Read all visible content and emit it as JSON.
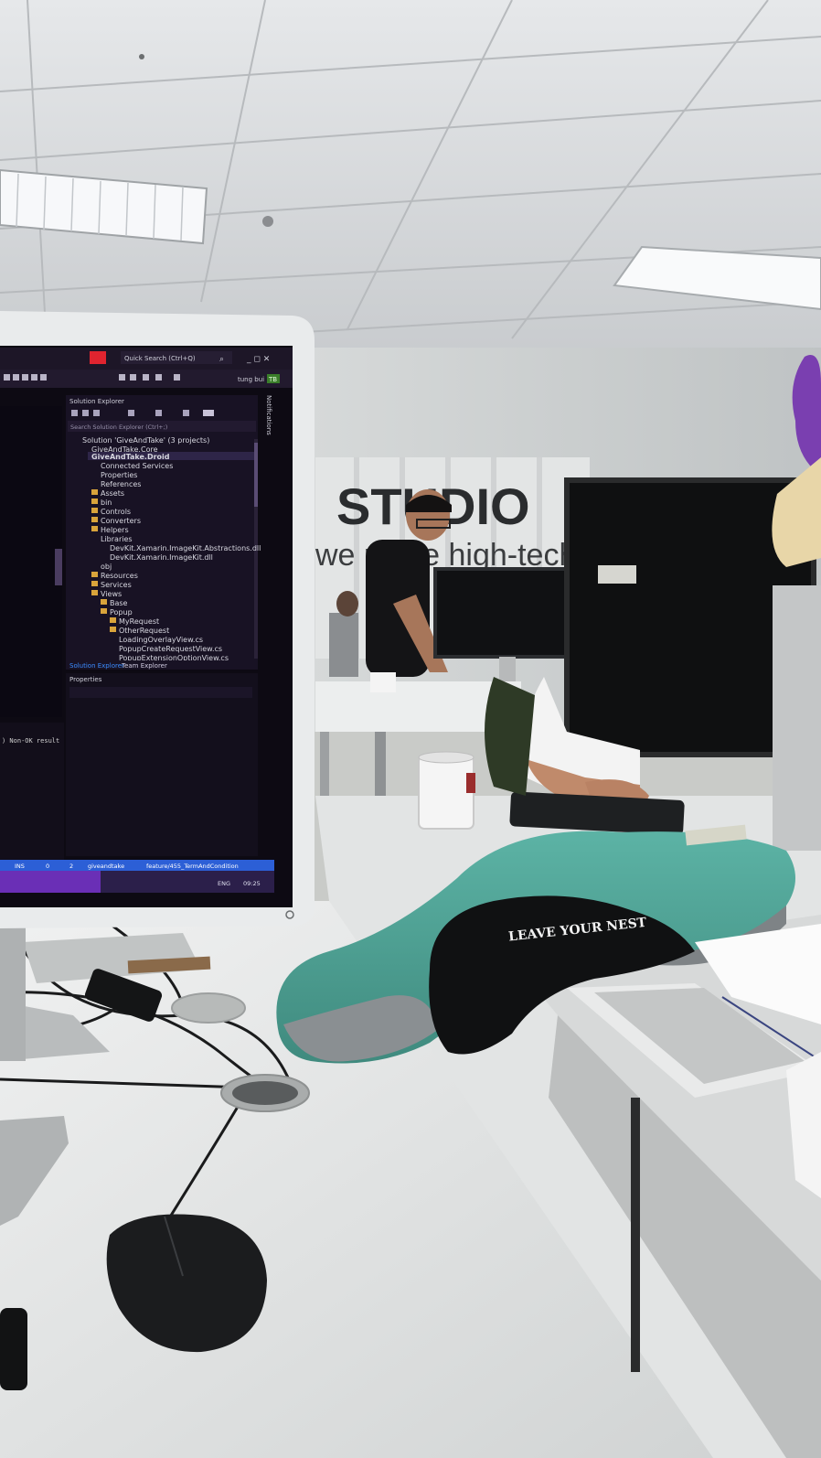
{
  "wall_sign": {
    "brand": "STUDIO",
    "tagline": "we make high-tech"
  },
  "pillow_print": "LEAVE YOUR NEST",
  "ide": {
    "quick_search": "Quick Search (Ctrl+Q)",
    "user": "tung bui",
    "user_badge": "TB",
    "panel_title": "Solution Explorer",
    "search_placeholder": "Search Solution Explorer (Ctrl+;)",
    "tree": [
      "Solution 'GiveAndTake' (3 projects)",
      "GiveAndTake.Core",
      "GiveAndTake.Droid",
      "Connected Services",
      "Properties",
      "References",
      "Assets",
      "bin",
      "Controls",
      "Converters",
      "Helpers",
      "Libraries",
      "DevKit.Xamarin.ImageKit.Abstractions.dll",
      "DevKit.Xamarin.ImageKit.dll",
      "obj",
      "Resources",
      "Services",
      "Views",
      "Base",
      "Popup",
      "MyRequest",
      "OtherRequest",
      "LoadingOverlayView.cs",
      "PopupCreateRequestView.cs",
      "PopupExtensionOptionView.cs"
    ],
    "tab_solution": "Solution Explorer",
    "tab_team": "Team Explorer",
    "properties_title": "Properties",
    "output_line": ") Non-OK result",
    "notifications": "Notifications",
    "status": {
      "ins": "INS",
      "errors": "0",
      "changes": "2",
      "repo": "giveandtake",
      "branch": "feature/455_TermAndCondition"
    },
    "taskbar": {
      "lang": "ENG",
      "clock": "09:25"
    }
  },
  "colors": {
    "ide_bg": "#1b1426",
    "ide_panel": "#23193a",
    "status_bar": "#2c5fd6",
    "accent_purple": "#8a3cff",
    "pillow_teal": "#4fa396",
    "desk_white": "#e4e6e6"
  }
}
